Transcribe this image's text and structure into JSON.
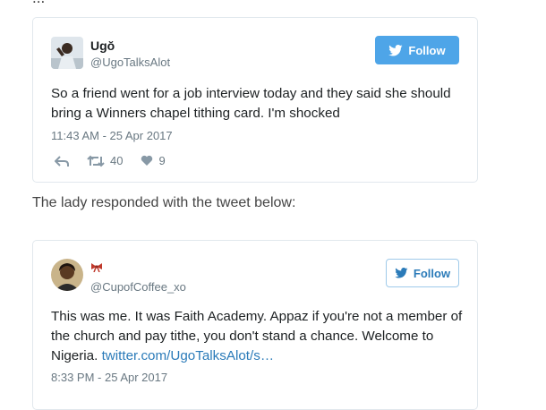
{
  "top_fragment": "...",
  "tweet1": {
    "name": "Ugŏ",
    "handle": "@UgoTalksAlot",
    "follow_label": "Follow",
    "text": "So a friend went for a job interview today and they said she should bring a Winners chapel tithing card. I'm shocked",
    "timestamp": "11:43 AM - 25 Apr 2017",
    "retweets": "40",
    "likes": "9"
  },
  "mid_text": "The lady responded with the tweet below:",
  "tweet2": {
    "handle": "@CupofCoffee_xo",
    "follow_label": "Follow",
    "text": "This was me. It was Faith Academy. Appaz if you're not a member of the church and pay tithe, you don't stand a chance. Welcome to Nigeria.",
    "link": "twitter.com/UgoTalksAlot/s…",
    "timestamp": "8:33 PM - 25 Apr 2017"
  },
  "colors": {
    "follow_filled": "#4ea5e8",
    "follow_outline": "#2b7bb9",
    "meta": "#697882"
  }
}
